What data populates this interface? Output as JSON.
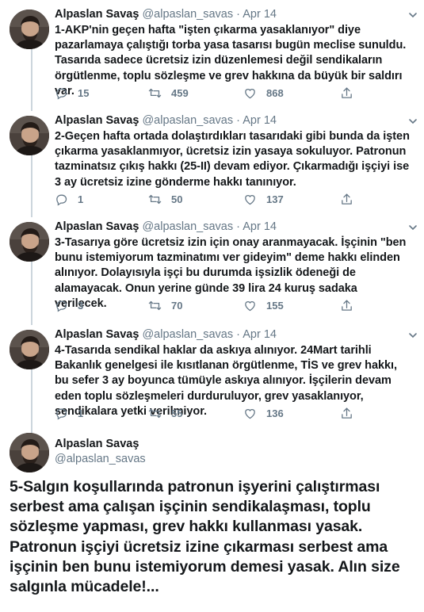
{
  "tweets": [
    {
      "name": "Alpaslan Savaş",
      "handle": "@alpaslan_savas",
      "date": "Apr 14",
      "text": "1-AKP'nin geçen hafta \"işten çıkarma yasaklanıyor\" diye pazarlamaya çalıştığı torba yasa tasarısı bugün meclise sunuldu. Tasarıda sadece ücretsiz izin düzenlemesi değil sendikaların örgütlenme, toplu sözleşme ve grev hakkına da büyük bir saldırı var.",
      "replies": "15",
      "retweets": "459",
      "likes": "868"
    },
    {
      "name": "Alpaslan Savaş",
      "handle": "@alpaslan_savas",
      "date": "Apr 14",
      "text": "2-Geçen hafta ortada dolaştırdıkları tasarıdaki gibi bunda da işten çıkarma yasaklanmıyor, ücretsiz izin yasaya sokuluyor. Patronun tazminatsız çıkış hakkı (25-II) devam ediyor. Çıkarmadığı işçiyi ise 3 ay ücretsiz izine gönderme hakkı tanınıyor.",
      "replies": "1",
      "retweets": "50",
      "likes": "137"
    },
    {
      "name": "Alpaslan Savaş",
      "handle": "@alpaslan_savas",
      "date": "Apr 14",
      "text": "3-Tasarıya göre ücretsiz izin için onay aranmayacak. İşçinin \"ben bunu istemiyorum tazminatımı ver gideyim\" deme hakkı elinden alınıyor. Dolayısıyla işçi bu durumda işsizlik ödeneği de alamayacak. Onun yerine günde 39 lira 24 kuruş sadaka verilecek.",
      "replies": "3",
      "retweets": "70",
      "likes": "155"
    },
    {
      "name": "Alpaslan Savaş",
      "handle": "@alpaslan_savas",
      "date": "Apr 14",
      "text": "4-Tasarıda sendikal haklar da askıya alınıyor. 24Mart tarihli Bakanlık genelgesi ile kısıtlanan örgütlenme, TİS ve grev hakkı, bu sefer 3 ay boyunca tümüyle askıya alınıyor. İşçilerin devam eden toplu sözleşmeleri durduruluyor, grev yasaklanıyor, sendikalara yetki verilmiyor.",
      "replies": "1",
      "retweets": "55",
      "likes": "136"
    }
  ],
  "main_tweet": {
    "name": "Alpaslan Savaş",
    "handle": "@alpaslan_savas",
    "text": "5-Salgın koşullarında patronun işyerini çalıştırması serbest ama çalışan işçinin sendikalaşması, toplu sözleşme yapması, grev hakkı kullanması yasak. Patronun işçiyi ücretsiz izine çıkarması serbest ama işçinin ben bunu istemiyorum demesi yasak. Alın size salgınla mücadele!..."
  },
  "separator": "·",
  "colors": {
    "text": "#14171a",
    "secondary": "#657786",
    "thread_line": "#ccd6dd"
  },
  "icons": [
    "reply-icon",
    "retweet-icon",
    "like-icon",
    "share-icon",
    "caret-down-icon"
  ]
}
